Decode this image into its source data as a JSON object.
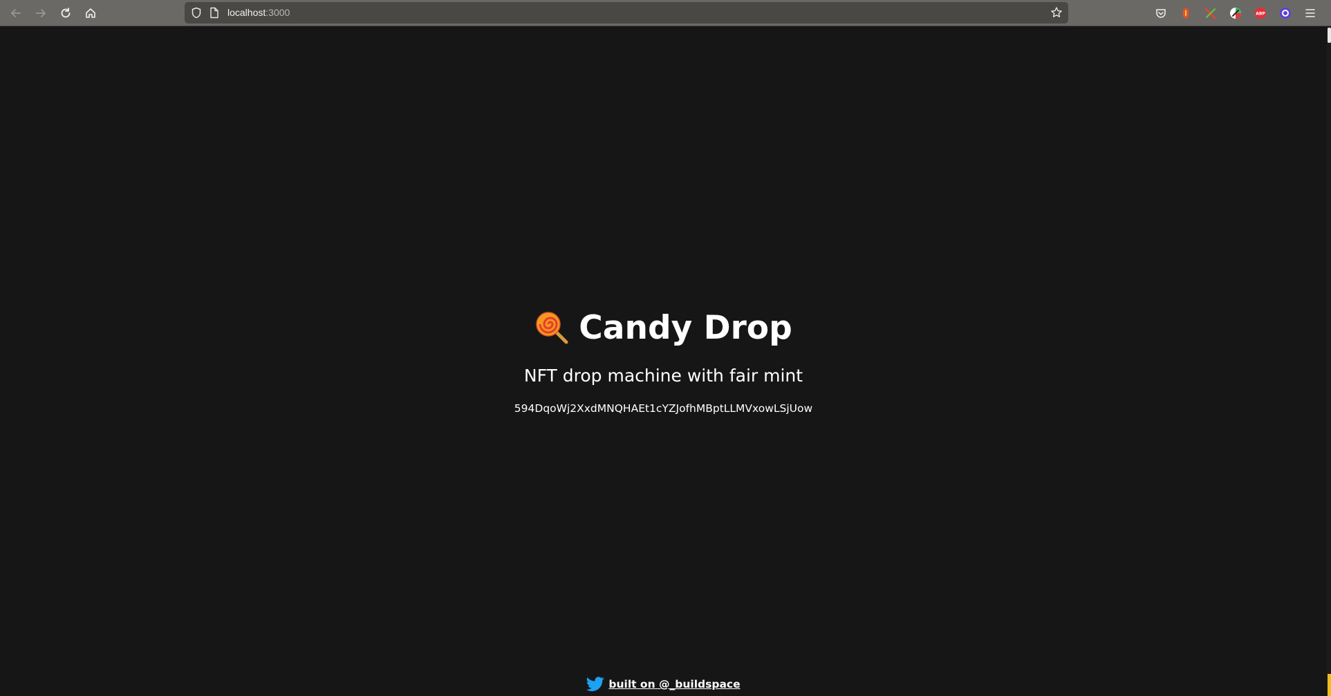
{
  "browser": {
    "url_host": "localhost",
    "url_port": ":3000"
  },
  "page": {
    "title": "Candy Drop",
    "subtitle": "NFT drop machine with fair mint",
    "address": "594DqoWj2XxdMNQHAEt1cYZJofhMBptLLMVxowLSjUow",
    "footer_link": "built on @_buildspace"
  },
  "colors": {
    "background": "#161616",
    "text": "#ffffff",
    "twitter": "#1da1f2",
    "toolbar": "#6b6966"
  },
  "icons": [
    "back-icon",
    "forward-icon",
    "reload-icon",
    "home-icon",
    "shield-icon",
    "page-icon",
    "bookmark-star-icon",
    "pocket-icon",
    "lollipop-icon",
    "twitter-icon"
  ]
}
